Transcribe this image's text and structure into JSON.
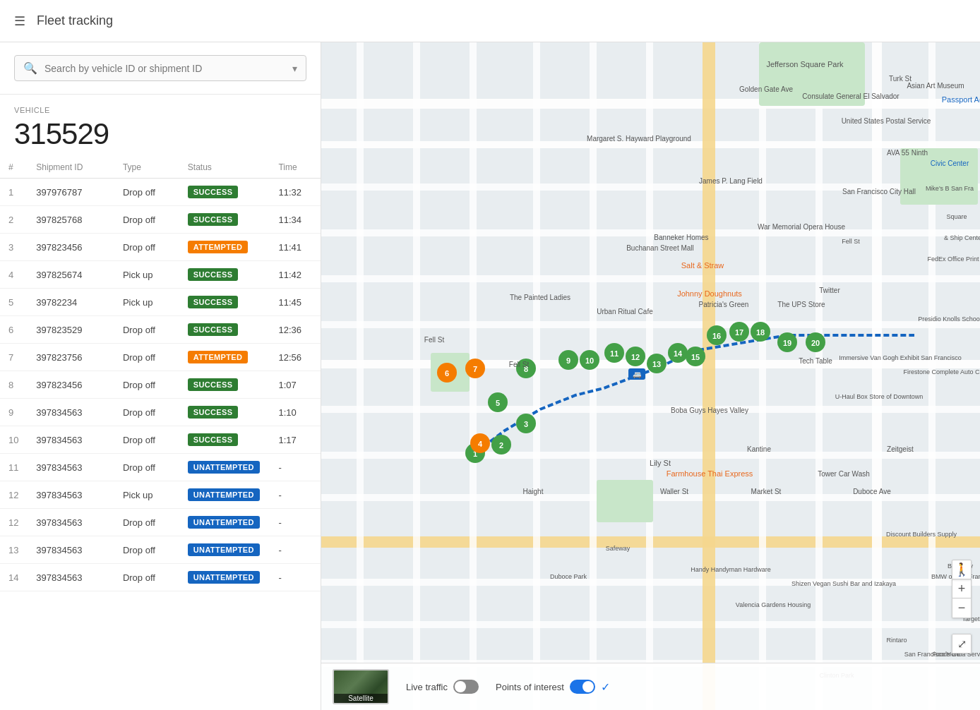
{
  "header": {
    "menu_icon": "☰",
    "title": "Fleet tracking"
  },
  "search": {
    "placeholder": "Search by vehicle ID or shipment ID"
  },
  "vehicle": {
    "label": "VEHICLE",
    "id": "315529"
  },
  "table": {
    "columns": [
      "#",
      "Shipment ID",
      "Type",
      "Status",
      "Time"
    ],
    "rows": [
      {
        "num": 1,
        "shipment_id": "397976787",
        "type": "Drop off",
        "status": "SUCCESS",
        "status_class": "badge-success",
        "time": "11:32"
      },
      {
        "num": 2,
        "shipment_id": "397825768",
        "type": "Drop off",
        "status": "SUCCESS",
        "status_class": "badge-success",
        "time": "11:34"
      },
      {
        "num": 3,
        "shipment_id": "397823456",
        "type": "Drop off",
        "status": "ATTEMPTED",
        "status_class": "badge-attempted",
        "time": "11:41"
      },
      {
        "num": 4,
        "shipment_id": "397825674",
        "type": "Pick up",
        "status": "SUCCESS",
        "status_class": "badge-success",
        "time": "11:42"
      },
      {
        "num": 5,
        "shipment_id": "39782234",
        "type": "Pick up",
        "status": "SUCCESS",
        "status_class": "badge-success",
        "time": "11:45"
      },
      {
        "num": 6,
        "shipment_id": "397823529",
        "type": "Drop off",
        "status": "SUCCESS",
        "status_class": "badge-success",
        "time": "12:36"
      },
      {
        "num": 7,
        "shipment_id": "397823756",
        "type": "Drop off",
        "status": "ATTEMPTED",
        "status_class": "badge-attempted",
        "time": "12:56"
      },
      {
        "num": 8,
        "shipment_id": "397823456",
        "type": "Drop off",
        "status": "SUCCESS",
        "status_class": "badge-success",
        "time": "1:07"
      },
      {
        "num": 9,
        "shipment_id": "397834563",
        "type": "Drop off",
        "status": "SUCCESS",
        "status_class": "badge-success",
        "time": "1:10"
      },
      {
        "num": 10,
        "shipment_id": "397834563",
        "type": "Drop off",
        "status": "SUCCESS",
        "status_class": "badge-success",
        "time": "1:17"
      },
      {
        "num": 11,
        "shipment_id": "397834563",
        "type": "Drop off",
        "status": "UNATTEMPTED",
        "status_class": "badge-unattempted",
        "time": "-"
      },
      {
        "num": 12,
        "shipment_id": "397834563",
        "type": "Pick up",
        "status": "UNATTEMPTED",
        "status_class": "badge-unattempted",
        "time": "-"
      },
      {
        "num": 12,
        "shipment_id": "397834563",
        "type": "Drop off",
        "status": "UNATTEMPTED",
        "status_class": "badge-unattempted",
        "time": "-"
      },
      {
        "num": 13,
        "shipment_id": "397834563",
        "type": "Drop off",
        "status": "UNATTEMPTED",
        "status_class": "badge-unattempted",
        "time": "-"
      },
      {
        "num": 14,
        "shipment_id": "397834563",
        "type": "Drop off",
        "status": "UNATTEMPTED",
        "status_class": "badge-unattempted",
        "time": "-"
      }
    ]
  },
  "map": {
    "live_traffic_label": "Live traffic",
    "points_of_interest_label": "Points of interest",
    "satellite_label": "Satellite",
    "live_traffic_on": false,
    "points_of_interest_on": true
  },
  "zoom_controls": {
    "zoom_in": "+",
    "zoom_out": "−"
  }
}
